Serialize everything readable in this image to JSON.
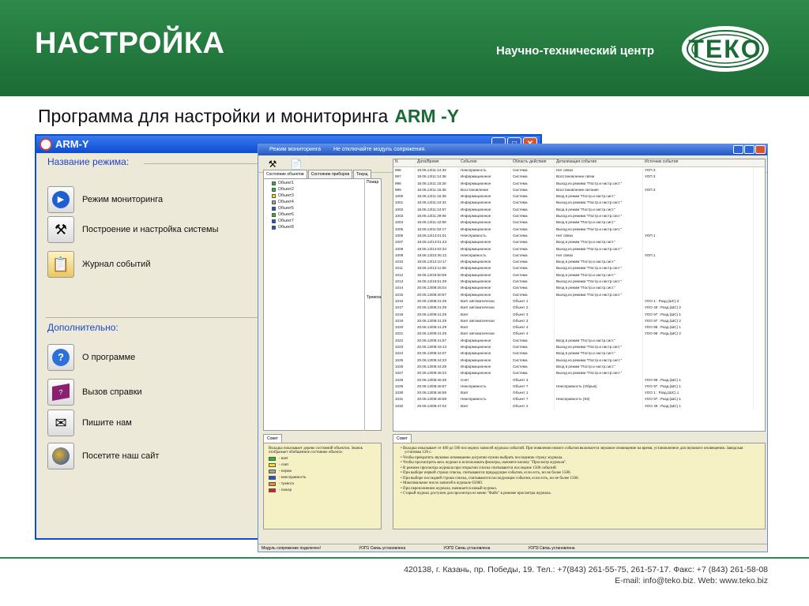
{
  "header": {
    "title": "НАСТРОЙКА",
    "org": "Научно-технический центр",
    "logo_text": "ТЕКО"
  },
  "subtitle": {
    "text": "Программа для настройки и мониторинга",
    "accent": "ARM -Y"
  },
  "arm_window": {
    "title": "ARM-Y",
    "group1": "Название режима:",
    "group2": "Дополнительно:",
    "items": [
      {
        "icon": "play-icon",
        "label": "Режим мониторинга"
      },
      {
        "icon": "tools-icon",
        "label": "Построение и настройка системы"
      },
      {
        "icon": "clipboard-icon",
        "label": "Журнал событий"
      },
      {
        "icon": "help-icon",
        "label": "О программе"
      },
      {
        "icon": "book-icon",
        "label": "Вызов справки"
      },
      {
        "icon": "envelope-icon",
        "label": "Пишите нам"
      },
      {
        "icon": "globe-icon",
        "label": "Посетите наш сайт"
      }
    ]
  },
  "monitor_window": {
    "title": "Режим мониторинга",
    "title_note": "Не отключайте модуль сопряжения.",
    "tabs": [
      "Состояние объектов",
      "Состояние приборов",
      "Текущ"
    ],
    "side_labels": [
      "Пожар",
      "Тревога"
    ],
    "objects": [
      {
        "label": "Объект1",
        "color": "#22c022"
      },
      {
        "label": "Объект2",
        "color": "#22c022"
      },
      {
        "label": "Объект3",
        "color": "#f0e020"
      },
      {
        "label": "Объект4",
        "color": "#a0a0a0"
      },
      {
        "label": "Объект5",
        "color": "#2050e0"
      },
      {
        "label": "Объект6",
        "color": "#22c022"
      },
      {
        "label": "Объект7",
        "color": "#2050e0"
      },
      {
        "label": "Объект8",
        "color": "#2050e0"
      }
    ],
    "log_headers": [
      "N",
      "Дата/Время",
      "Событие",
      "Область действия",
      "Детализация события",
      "Источник события"
    ],
    "log_rows": [
      [
        "996",
        "18.06.13/11:14:33",
        "Неисправность",
        "Система",
        "Нет связи",
        "УОП 3"
      ],
      [
        "997",
        "18.06.13/11:14:36",
        "Информационное",
        "Система",
        "Восстановление связи",
        "УОП 3"
      ],
      [
        "998",
        "18.06.13/11:15:28",
        "Информационное",
        "Система",
        "Выход из режима \"Постр.и настр.сист.\"",
        ""
      ],
      [
        "999",
        "18.06.13/11:15:35",
        "Восстановление",
        "Система",
        "Восстановление питания",
        "УОП 3"
      ],
      [
        "1000",
        "18.06.13/11:16:39",
        "Информационное",
        "Система",
        "Вход в режим \"Постр.и настр.сист.\"",
        ""
      ],
      [
        "1001",
        "18.06.13/11:24:33",
        "Информационное",
        "Система",
        "Выход из режима \"Постр.и настр.сист.\"",
        ""
      ],
      [
        "1002",
        "18.06.13/11:24:57",
        "Информационное",
        "Система",
        "Вход в режим \"Постр.и настр.сист.\"",
        ""
      ],
      [
        "1003",
        "18.06.13/11:29:08",
        "Информационное",
        "Система",
        "Выход из режима \"Постр.и настр.сист.\"",
        ""
      ],
      [
        "1004",
        "18.06.13/11:42:59",
        "Информационное",
        "Система",
        "Вход в режим \"Постр.и настр.сист.\"",
        ""
      ],
      [
        "1005",
        "18.06.13/11:52:17",
        "Информационное",
        "Система",
        "Выход из режима \"Постр.и настр.сист.\"",
        ""
      ],
      [
        "1006",
        "18.06.13/14:01:01",
        "Неисправность",
        "Система",
        "Нет связи",
        "УОП 1"
      ],
      [
        "1007",
        "18.06.13/14:01:43",
        "Информационное",
        "Система",
        "Вход в режим \"Постр.и настр.сист.\"",
        ""
      ],
      [
        "1008",
        "18.06.13/14:02:34",
        "Информационное",
        "Система",
        "Выход из режима \"Постр.и настр.сист.\"",
        ""
      ],
      [
        "1009",
        "19.06.13/10:35:12",
        "Неисправность",
        "Система",
        "Нет связи",
        "УОП 1"
      ],
      [
        "1010",
        "19.06.13/12:10:17",
        "Информационное",
        "Система",
        "Вход в режим \"Постр.и настр.сист.\"",
        ""
      ],
      [
        "1011",
        "19.06.13/13:11:59",
        "Информационное",
        "Система",
        "Выход из режима \"Постр.и настр.сист.\"",
        ""
      ],
      [
        "1012",
        "19.06.13/15:50:59",
        "Информационное",
        "Система",
        "Вход в режим \"Постр.и настр.сист.\"",
        ""
      ],
      [
        "1013",
        "19.06.13/16:51:29",
        "Информационное",
        "Система",
        "Выход из режима \"Постр.и настр.сист.\"",
        ""
      ],
      [
        "1014",
        "20.06.13/08:25:04",
        "Информационное",
        "Система",
        "Вход в режим \"Постр.и настр.сист.\"",
        ""
      ],
      [
        "1015",
        "20.06.13/08:40:57",
        "Информационное",
        "Система",
        "Выход из режима \"Постр.и настр.сист.\"",
        ""
      ],
      [
        "1016",
        "20.06.13/08:41:28",
        "Взят автоматически",
        "Объект 1",
        "",
        "УОО 1 : Разд.(ШС) 2"
      ],
      [
        "1017",
        "20.06.13/08:41:29",
        "Взят автоматически",
        "Объект 2",
        "",
        "УОО 49 : Разд.(ШС) 2"
      ],
      [
        "1018",
        "20.06.13/08:41:29",
        "Взят",
        "Объект 3",
        "",
        "УОО 97 : Разд.(ШС) 1"
      ],
      [
        "1019",
        "20.06.13/08:41:29",
        "Взят автоматически",
        "Объект 3",
        "",
        "УОО 97 : Разд.(ШС) 2"
      ],
      [
        "1020",
        "20.06.13/08:41:29",
        "Взят",
        "Объект 4",
        "",
        "УОО 98 : Разд.(ШС) 1"
      ],
      [
        "1021",
        "20.06.13/08:41:29",
        "Взят автоматически",
        "Объект 4",
        "",
        "УОО 98 : Разд.(ШС) 2"
      ],
      [
        "1022",
        "20.06.13/08:41:57",
        "Информационное",
        "Система",
        "Вход в режим \"Постр.и настр.сист.\"",
        ""
      ],
      [
        "1023",
        "20.06.13/08:43:13",
        "Информационное",
        "Система",
        "Выход из режима \"Постр.и настр.сист.\"",
        ""
      ],
      [
        "1024",
        "20.06.13/08:44:07",
        "Информационное",
        "Система",
        "Вход в режим \"Постр.и настр.сист.\"",
        ""
      ],
      [
        "1025",
        "20.06.13/08:44:23",
        "Информационное",
        "Система",
        "Выход из режима \"Постр.и настр.сист.\"",
        ""
      ],
      [
        "1026",
        "20.06.13/08:44:29",
        "Информационное",
        "Система",
        "Вход в режим \"Постр.и настр.сист.\"",
        ""
      ],
      [
        "1027",
        "20.06.13/08:46:23",
        "Информационное",
        "Система",
        "Выход из режима \"Постр.и настр.сист.\"",
        ""
      ],
      [
        "1028",
        "20.06.13/08:46:48",
        "Снят",
        "Объект 4",
        "",
        "УОО 98 : Разд.(ШС) 1"
      ],
      [
        "1029",
        "20.06.13/08:46:57",
        "Неисправность",
        "Объект 7",
        "Неисправность (Обрыв)",
        "УОО 97 : Разд.(ШС) 1"
      ],
      [
        "1030",
        "20.06.13/08:46:58",
        "Взят",
        "Объект 1",
        "",
        "УОО 1 : Разд.(ШС) 1"
      ],
      [
        "1031",
        "20.06.13/08:46:59",
        "Неисправность",
        "Объект 7",
        "Неисправность (КЗ)",
        "УОО 97 : Разд.(ШС) 1"
      ],
      [
        "1032",
        "20.06.13/08:47:02",
        "Взят",
        "Объект 2",
        "",
        "УОО 49 : Разд.(ШС) 1"
      ]
    ],
    "hint_tab": "Совет",
    "hint_left": "Вкладка показывает дерево состояний объектов. Значок отображает обобщенное состояние объекта:",
    "legend": [
      {
        "label": "- взят",
        "color": "#22c022"
      },
      {
        "label": "- снят",
        "color": "#f0e020"
      },
      {
        "label": "- норма",
        "color": "#a0a0a0"
      },
      {
        "label": "- неисправность",
        "color": "#2050e0"
      },
      {
        "label": "- тревога",
        "color": "#e89020"
      },
      {
        "label": "- пожар",
        "color": "#e02020"
      }
    ],
    "hint_right": [
      "Вкладка показывает от 400 до 500 последних записей журнала событий. При появлении нового события включается звуковое оповещение на время, установленное для звукового оповещения. Заводская установка 120 с.",
      "Чтобы прекратить звуковое оповещение досрочно нужно выбрать последнюю строку журнала.",
      "Чтобы просмотреть весь журнал и использовать фильтры, нажмите кнопку \"Просмотр журнала\".",
      "В режиме просмотра журнала при открытии списка считываются последние 1500 событий.",
      "При выборе первой строки списка, считываются предыдущие события, если есть, но не более 1500.",
      "При выборе последней строки списка, считываются последующие события, если есть, но не более 1500.",
      "Максимальное число записей в журнале 65000.",
      "При переполнении журнала, начинается новый журнал.",
      "Старый журнал доступен для просмотра из меню \"Файл\" в режиме просмотра журнала."
    ],
    "status": [
      "Модуль сопряжение подключен!",
      "УОП1 Связь установлена",
      "УОП2 Связь установлена",
      "УОП3 Связь установлена"
    ]
  },
  "footer": {
    "address": "420138, г. Казань, пр. Победы, 19. Тел.: +7(843) 261-55-75, 261-57-17. Факс: +7 (843) 261-58-08",
    "contacts": "E-mail: info@teko.biz. Web: www.teko.biz"
  }
}
